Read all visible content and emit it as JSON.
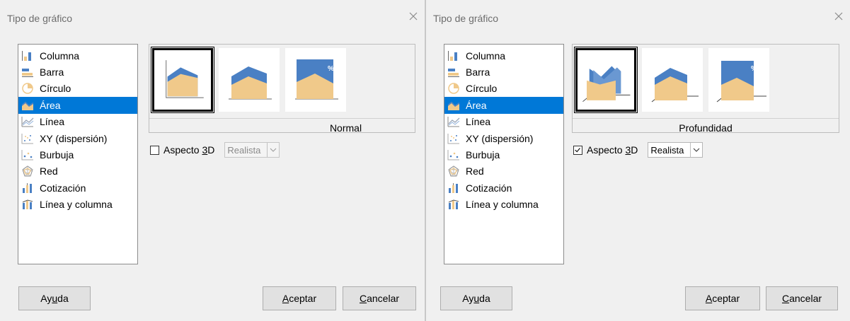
{
  "dialogs": [
    {
      "title": "Tipo de gráfico",
      "selected_type_index": 3,
      "variants": [
        "normal",
        "stacked",
        "percent"
      ],
      "selected_variant_index": 0,
      "variant_caption": "Normal",
      "aspect3d": {
        "checked": false,
        "label_pre": "Aspecto ",
        "label_key": "3",
        "label_post": "D"
      },
      "shading": {
        "value": "Realista",
        "enabled": false
      },
      "buttons": {
        "help": {
          "pre": "Ay",
          "key": "u",
          "post": "da"
        },
        "ok": {
          "pre": "",
          "key": "A",
          "post": "ceptar"
        },
        "cancel": {
          "pre": "",
          "key": "C",
          "post": "ancelar"
        }
      }
    },
    {
      "title": "Tipo de gráfico",
      "selected_type_index": 3,
      "variants": [
        "depth",
        "stacked3d",
        "percent3d"
      ],
      "selected_variant_index": 0,
      "variant_caption": "Profundidad",
      "aspect3d": {
        "checked": true,
        "label_pre": "Aspecto ",
        "label_key": "3",
        "label_post": "D"
      },
      "shading": {
        "value": "Realista",
        "enabled": true
      },
      "buttons": {
        "help": {
          "pre": "Ay",
          "key": "u",
          "post": "da"
        },
        "ok": {
          "pre": "",
          "key": "A",
          "post": "ceptar"
        },
        "cancel": {
          "pre": "",
          "key": "C",
          "post": "ancelar"
        }
      }
    }
  ],
  "chart_types": [
    {
      "label": "Columna",
      "icon": "column-chart-icon"
    },
    {
      "label": "Barra",
      "icon": "bar-chart-icon"
    },
    {
      "label": "Círculo",
      "icon": "pie-chart-icon"
    },
    {
      "label": "Área",
      "icon": "area-chart-icon"
    },
    {
      "label": "Línea",
      "icon": "line-chart-icon"
    },
    {
      "label": "XY (dispersión)",
      "icon": "scatter-chart-icon"
    },
    {
      "label": "Burbuja",
      "icon": "bubble-chart-icon"
    },
    {
      "label": "Red",
      "icon": "net-chart-icon"
    },
    {
      "label": "Cotización",
      "icon": "stock-chart-icon"
    },
    {
      "label": "Línea y columna",
      "icon": "line-column-chart-icon"
    }
  ],
  "percent_symbol": "%",
  "colors": {
    "selection": "#0078d7",
    "area_fill": "#f0c98a",
    "area_blue": "#4a80c4"
  }
}
